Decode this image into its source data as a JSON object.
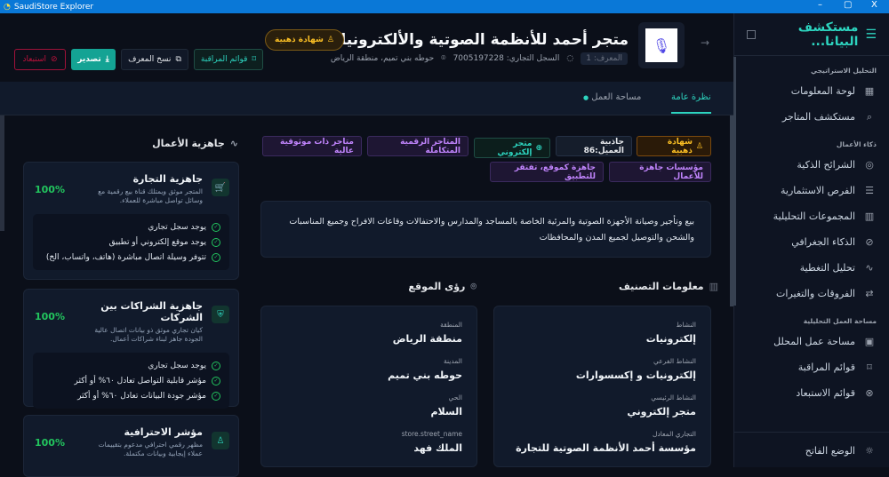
{
  "window": {
    "title": "SaudiStore Explorer",
    "minimize": "–",
    "maximize": "▢",
    "close": "X"
  },
  "sidebar": {
    "title": "مستكشف البيانا...",
    "sections": [
      {
        "label": "التحليل الاستراتيجي",
        "items": [
          {
            "label": "لوحة المعلومات",
            "icon": "dashboard-icon",
            "glyph": "▦"
          },
          {
            "label": "مستكشف المتاجر",
            "icon": "search-icon",
            "glyph": "⌕"
          }
        ]
      },
      {
        "label": "ذكاء الأعمال",
        "items": [
          {
            "label": "الشرائح الذكية",
            "icon": "target-icon",
            "glyph": "◎"
          },
          {
            "label": "الفرص الاستثمارية",
            "icon": "database-icon",
            "glyph": "☰"
          },
          {
            "label": "المجموعات التحليلية",
            "icon": "columns-icon",
            "glyph": "▥"
          },
          {
            "label": "الذكاء الجغرافي",
            "icon": "compass-icon",
            "glyph": "⊘"
          },
          {
            "label": "تحليل التغطية",
            "icon": "activity-icon",
            "glyph": "∿"
          },
          {
            "label": "الفروقات والتغيرات",
            "icon": "swap-icon",
            "glyph": "⇄"
          }
        ]
      },
      {
        "label": "مساحة العمل التحليلية",
        "items": [
          {
            "label": "مساحة عمل المحلل",
            "icon": "briefcase-icon",
            "glyph": "▣"
          },
          {
            "label": "قوائم المراقبة",
            "icon": "bookmark-icon",
            "glyph": "⌑"
          },
          {
            "label": "قوائم الاستبعاد",
            "icon": "shield-off-icon",
            "glyph": "⊗"
          }
        ]
      }
    ],
    "footer": {
      "label": "الوضع الفاتح"
    }
  },
  "header": {
    "store_name": "متجر أحمد للأنظمة الصوتية والألكترونيات",
    "gold_badge": "شهادة ذهبية",
    "id_label": "المعرف:",
    "id_value": "1",
    "cr_label": "السجل التجاري:",
    "cr_value": "7005197228",
    "location": "حوطه بني تميم، منطقة الرياض",
    "buttons": {
      "watchlist": "قوائم المراقبة",
      "copy_id": "نسخ المعرف",
      "export": "تصدير",
      "exclude": "استبعاد"
    }
  },
  "tabs": [
    {
      "label": "نظرة عامة",
      "active": true
    },
    {
      "label": "مساحة العمل",
      "active": false
    }
  ],
  "badges": {
    "gold": "شهادة ذهبية",
    "attractiveness": "جاذبية العميل:86",
    "ecommerce": "متجر إلكتروني",
    "integrated": "المتاجر الرقمية المتكاملة",
    "reliable": "متاجر ذات موثوقية عالية",
    "business_ready": "مؤسسات جاهزة للأعمال",
    "web_ready": "جاهزة كموقع، تفتقر للتطبيق"
  },
  "description": "بيع وتأجير وصيانة الأجهزة الصوتية والمرئية الخاصة بالمساجد والمدارس والاحتفالات وقاعات الافراح وجميع المناسبات والشحن والتوصيل لجميع المدن والمحافظات",
  "classification": {
    "title": "معلومات التصنيف",
    "fields": [
      {
        "label": "النشاط",
        "value": "إلكترونيات"
      },
      {
        "label": "النشاط الفرعي",
        "value": "إلكترونيات و إكسسوارات"
      },
      {
        "label": "النشاط الرئيسي",
        "value": "متجر إلكتروني"
      },
      {
        "label": "التجاري المعادل",
        "value": "مؤسسة أحمد الأنظمة الصوتية للتجارة"
      }
    ]
  },
  "location": {
    "title": "رؤى الموقع",
    "fields": [
      {
        "label": "المنطقة",
        "value": "منطقة الرياض"
      },
      {
        "label": "المدينة",
        "value": "حوطه بني تميم"
      },
      {
        "label": "الحي",
        "value": "السلام"
      },
      {
        "label": "store.street_name",
        "value": "الملك فهد"
      }
    ]
  },
  "readiness": {
    "title": "جاهزية الأعمال",
    "cards": [
      {
        "title": "جاهزية التجارة",
        "desc": "المتجر موثق ويمتلك قناة بيع رقمية مع وسائل تواصل مباشرة للعملاء.",
        "percent": "100%",
        "checks": [
          "يوجد سجل تجاري",
          "يوجد موقع إلكتروني أو تطبيق",
          "تتوفر وسيلة اتصال مباشرة (هاتف، واتساب، الخ)"
        ]
      },
      {
        "title": "جاهزية الشراكات بين الشركات",
        "desc": "كيان تجاري موثق ذو بيانات اتصال عالية الجودة جاهز لبناء شراكات أعمال.",
        "percent": "100%",
        "checks": [
          "يوجد سجل تجاري",
          "مؤشر قابلية التواصل تعادل ٦٠% أو أكثر",
          "مؤشر جودة البيانات تعادل ٦٠% أو أكثر"
        ]
      },
      {
        "title": "مؤشر الاحترافية",
        "desc": "مظهر رقمي احترافي مدعوم بتقييمات عملاء إيجابية وبيانات مكتملة.",
        "percent": "100%",
        "checks": []
      }
    ]
  }
}
